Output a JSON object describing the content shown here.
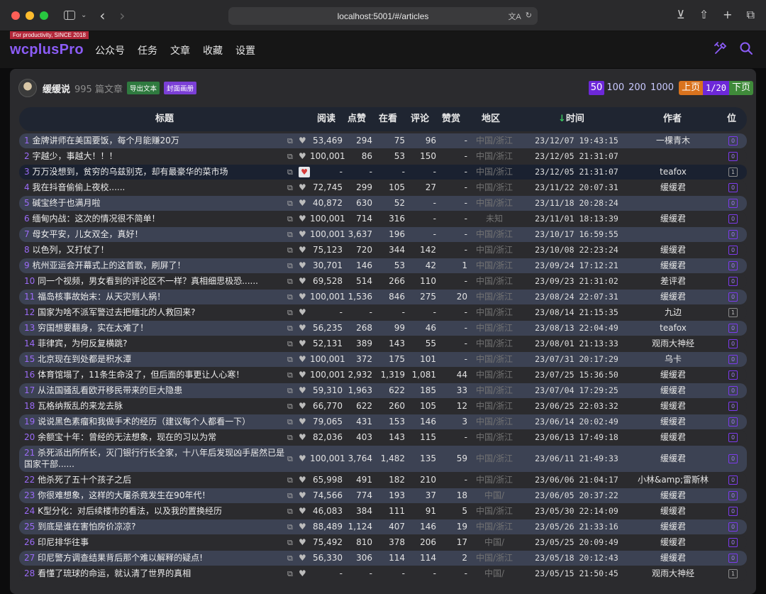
{
  "browser": {
    "url": "localhost:5001/#/articles"
  },
  "app": {
    "tagline": "For productivity, SINCE 2018",
    "brand": "wcplusPro",
    "nav": [
      "公众号",
      "任务",
      "文章",
      "收藏",
      "设置"
    ]
  },
  "account": {
    "name": "缓缓说",
    "count": "995 篇文章",
    "export_label": "导出文本",
    "cover_label": "封面画册"
  },
  "pager": {
    "sizes": [
      "50",
      "100",
      "200",
      "1000"
    ],
    "active_size": "50",
    "prev": "上页",
    "page": "1/20",
    "next": "下页"
  },
  "table": {
    "headers": {
      "title": "标题",
      "read": "阅读",
      "like": "点赞",
      "seeing": "在看",
      "comment": "评论",
      "reward": "赞赏",
      "region": "地区",
      "time_arrow": "↓",
      "time": "时间",
      "author": "作者",
      "position": "位"
    },
    "rows": [
      {
        "idx": "1",
        "title": "金牌讲师在美国要饭，每个月能赚20万",
        "read": "53,469",
        "like": "294",
        "seeing": "75",
        "comment": "96",
        "reward": "-",
        "region": "中国/浙江",
        "time": "23/12/07 19:43:15",
        "author": "一棵青木",
        "pos": "0"
      },
      {
        "idx": "2",
        "title": "字越少，事越大！！！",
        "read": "100,001",
        "like": "86",
        "seeing": "53",
        "comment": "150",
        "reward": "-",
        "region": "中国/浙江",
        "time": "23/12/05 21:31:07",
        "author": "",
        "pos": "0"
      },
      {
        "idx": "3",
        "title": "万万没想到，贫穷的乌兹别克，却有最豪华的菜市场",
        "read": "-",
        "like": "-",
        "seeing": "-",
        "comment": "-",
        "reward": "-",
        "region": "中国/浙江",
        "time": "23/12/05 21:31:07",
        "author": "teafox",
        "pos": "1"
      },
      {
        "idx": "4",
        "title": "我在抖音偷偷上夜校......",
        "read": "72,745",
        "like": "299",
        "seeing": "105",
        "comment": "27",
        "reward": "-",
        "region": "中国/浙江",
        "time": "23/11/22 20:07:31",
        "author": "缓缓君",
        "pos": "0"
      },
      {
        "idx": "5",
        "title": "碱宝终于也满月啦",
        "read": "40,872",
        "like": "630",
        "seeing": "52",
        "comment": "-",
        "reward": "-",
        "region": "中国/浙江",
        "time": "23/11/18 20:28:24",
        "author": "",
        "pos": "0"
      },
      {
        "idx": "6",
        "title": "缅甸内战：这次的情况很不简单！",
        "read": "100,001",
        "like": "714",
        "seeing": "316",
        "comment": "-",
        "reward": "-",
        "region": "未知",
        "time": "23/11/01 18:13:39",
        "author": "缓缓君",
        "pos": "0"
      },
      {
        "idx": "7",
        "title": "母女平安，儿女双全，真好！",
        "read": "100,001",
        "like": "3,637",
        "seeing": "196",
        "comment": "-",
        "reward": "-",
        "region": "中国/浙江",
        "time": "23/10/17 16:59:55",
        "author": "",
        "pos": "0"
      },
      {
        "idx": "8",
        "title": "以色列，又打仗了！",
        "read": "75,123",
        "like": "720",
        "seeing": "344",
        "comment": "142",
        "reward": "-",
        "region": "中国/浙江",
        "time": "23/10/08 22:23:24",
        "author": "缓缓君",
        "pos": "0"
      },
      {
        "idx": "9",
        "title": "杭州亚运会开幕式上的这首歌，刷屏了！",
        "read": "30,701",
        "like": "146",
        "seeing": "53",
        "comment": "42",
        "reward": "1",
        "region": "中国/浙江",
        "time": "23/09/24 17:12:21",
        "author": "缓缓君",
        "pos": "0"
      },
      {
        "idx": "10",
        "title": "同一个视频，男女看到的评论区不一样？真相细思极恐......",
        "read": "69,528",
        "like": "514",
        "seeing": "266",
        "comment": "110",
        "reward": "-",
        "region": "中国/浙江",
        "time": "23/09/23 21:31:02",
        "author": "差评君",
        "pos": "0"
      },
      {
        "idx": "11",
        "title": "福岛核事故始末：从天灾到人祸！",
        "read": "100,001",
        "like": "1,536",
        "seeing": "846",
        "comment": "275",
        "reward": "20",
        "region": "中国/浙江",
        "time": "23/08/24 22:07:31",
        "author": "缓缓君",
        "pos": "0"
      },
      {
        "idx": "12",
        "title": "国家为啥不派军警过去把缅北的人救回来?",
        "read": "-",
        "like": "-",
        "seeing": "-",
        "comment": "-",
        "reward": "-",
        "region": "中国/浙江",
        "time": "23/08/14 21:15:35",
        "author": "九边",
        "pos": "1"
      },
      {
        "idx": "13",
        "title": "穷国想要翻身，实在太难了！",
        "read": "56,235",
        "like": "268",
        "seeing": "99",
        "comment": "46",
        "reward": "-",
        "region": "中国/浙江",
        "time": "23/08/13 22:04:49",
        "author": "teafox",
        "pos": "0"
      },
      {
        "idx": "14",
        "title": "菲律宾，为何反复横跳?",
        "read": "52,131",
        "like": "389",
        "seeing": "143",
        "comment": "55",
        "reward": "-",
        "region": "中国/浙江",
        "time": "23/08/01 21:13:33",
        "author": "观雨大神经",
        "pos": "0"
      },
      {
        "idx": "15",
        "title": "北京现在到处都是积水潭",
        "read": "100,001",
        "like": "372",
        "seeing": "175",
        "comment": "101",
        "reward": "-",
        "region": "中国/浙江",
        "time": "23/07/31 20:17:29",
        "author": "乌卡",
        "pos": "0"
      },
      {
        "idx": "16",
        "title": "体育馆塌了，11条生命没了，但后面的事更让人心寒！",
        "read": "100,001",
        "like": "2,932",
        "seeing": "1,319",
        "comment": "1,081",
        "reward": "44",
        "region": "中国/浙江",
        "time": "23/07/25 15:36:50",
        "author": "缓缓君",
        "pos": "0"
      },
      {
        "idx": "17",
        "title": "从法国骚乱看欧开移民带来的巨大隐患",
        "read": "59,310",
        "like": "1,963",
        "seeing": "622",
        "comment": "185",
        "reward": "33",
        "region": "中国/浙江",
        "time": "23/07/04 17:29:25",
        "author": "缓缓君",
        "pos": "0"
      },
      {
        "idx": "18",
        "title": "瓦格纳叛乱的来龙去脉",
        "read": "66,770",
        "like": "622",
        "seeing": "260",
        "comment": "105",
        "reward": "12",
        "region": "中国/浙江",
        "time": "23/06/25 22:03:32",
        "author": "缓缓君",
        "pos": "0"
      },
      {
        "idx": "19",
        "title": "说说黑色素瘤和我做手术的经历（建议每个人都看一下）",
        "read": "79,065",
        "like": "431",
        "seeing": "153",
        "comment": "146",
        "reward": "3",
        "region": "中国/浙江",
        "time": "23/06/14 20:02:49",
        "author": "缓缓君",
        "pos": "0"
      },
      {
        "idx": "20",
        "title": "余额宝十年：曾经的无法想象，现在的习以为常",
        "read": "82,036",
        "like": "403",
        "seeing": "143",
        "comment": "115",
        "reward": "-",
        "region": "中国/浙江",
        "time": "23/06/13 17:49:18",
        "author": "缓缓君",
        "pos": "0"
      },
      {
        "idx": "21",
        "title": "杀死派出所所长，灭门银行行长全家，十八年后发现凶手居然已是国家干部......",
        "read": "100,001",
        "like": "3,764",
        "seeing": "1,482",
        "comment": "135",
        "reward": "59",
        "region": "中国/浙江",
        "time": "23/06/11 21:49:33",
        "author": "缓缓君",
        "pos": "0"
      },
      {
        "idx": "22",
        "title": "他杀死了五十个孩子之后",
        "read": "65,998",
        "like": "491",
        "seeing": "182",
        "comment": "210",
        "reward": "-",
        "region": "中国/浙江",
        "time": "23/06/06 21:04:17",
        "author": "小林&amp;雷斯林",
        "pos": "0"
      },
      {
        "idx": "23",
        "title": "你很难想象，这样的大屠杀竟发生在90年代！",
        "read": "74,566",
        "like": "774",
        "seeing": "193",
        "comment": "37",
        "reward": "18",
        "region": "中国/",
        "time": "23/06/05 20:37:22",
        "author": "缓缓君",
        "pos": "0"
      },
      {
        "idx": "24",
        "title": "K型分化：对后续楼市的看法，以及我的置换经历",
        "read": "46,083",
        "like": "384",
        "seeing": "111",
        "comment": "91",
        "reward": "5",
        "region": "中国/浙江",
        "time": "23/05/30 22:14:09",
        "author": "缓缓君",
        "pos": "0"
      },
      {
        "idx": "25",
        "title": "到底是谁在害怕房价凉凉?",
        "read": "88,489",
        "like": "1,124",
        "seeing": "407",
        "comment": "146",
        "reward": "19",
        "region": "中国/浙江",
        "time": "23/05/26 21:33:16",
        "author": "缓缓君",
        "pos": "0"
      },
      {
        "idx": "26",
        "title": "印尼排华往事",
        "read": "75,492",
        "like": "810",
        "seeing": "378",
        "comment": "206",
        "reward": "17",
        "region": "中国/",
        "time": "23/05/25 20:09:49",
        "author": "缓缓君",
        "pos": "0"
      },
      {
        "idx": "27",
        "title": "印尼警方调查结果背后那个难以解释的疑点!",
        "read": "56,330",
        "like": "306",
        "seeing": "114",
        "comment": "114",
        "reward": "2",
        "region": "中国/浙江",
        "time": "23/05/18 20:12:43",
        "author": "缓缓君",
        "pos": "0"
      },
      {
        "idx": "28",
        "title": "看懂了琉球的命运，就认清了世界的真相",
        "read": "-",
        "like": "-",
        "seeing": "-",
        "comment": "-",
        "reward": "-",
        "region": "中国/",
        "time": "23/05/15 21:50:45",
        "author": "观雨大神经",
        "pos": "1"
      }
    ]
  }
}
